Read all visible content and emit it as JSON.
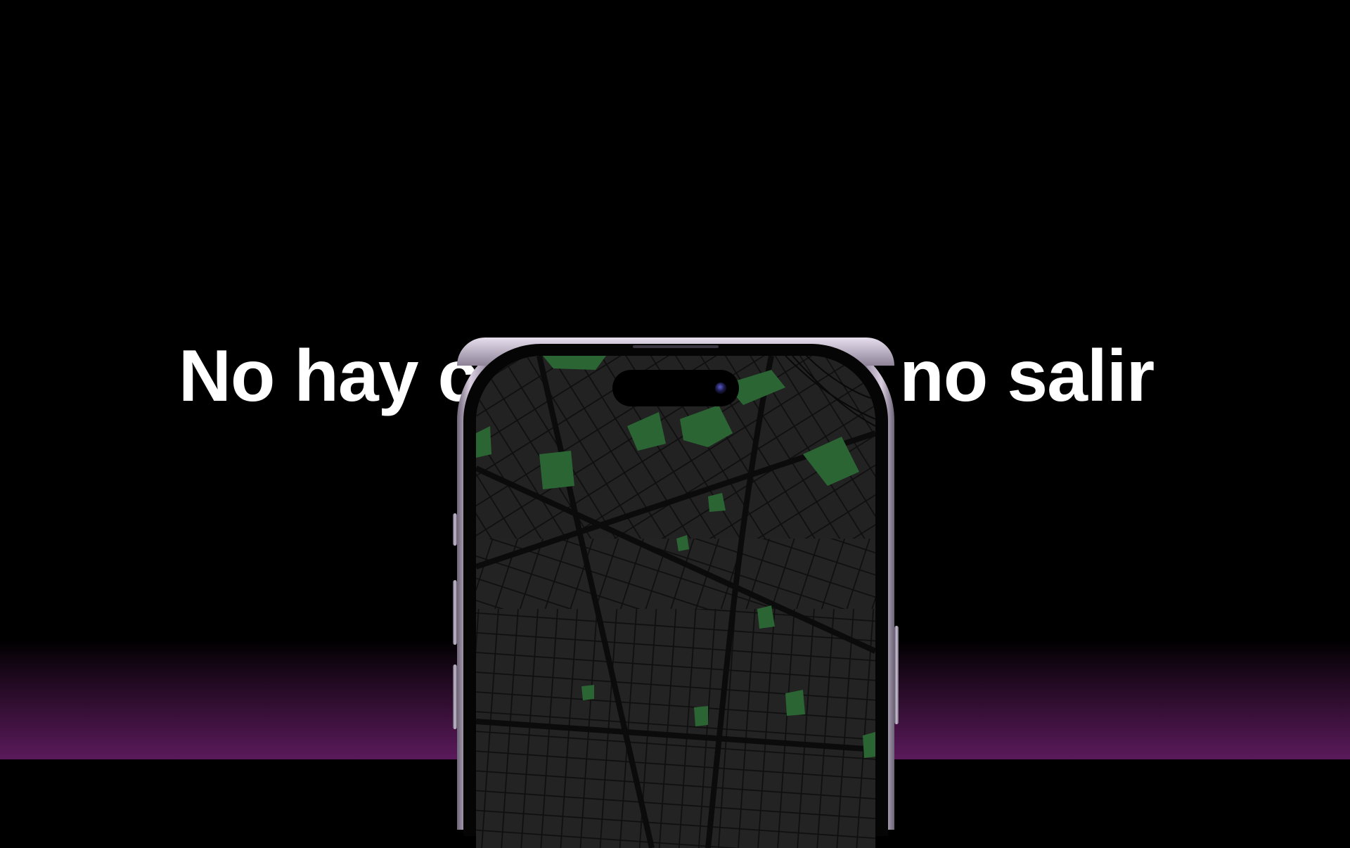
{
  "headline": {
    "left_text": "No hay c",
    "right_text": "no salir"
  },
  "device": {
    "model": "smartphone",
    "frame_color": "#cfc4d8",
    "screen_content": "dark street map",
    "park_color": "#2f6e39",
    "road_color": "#111111"
  },
  "colors": {
    "background": "#000000",
    "glow": "#5a1a5a",
    "text": "#ffffff"
  }
}
